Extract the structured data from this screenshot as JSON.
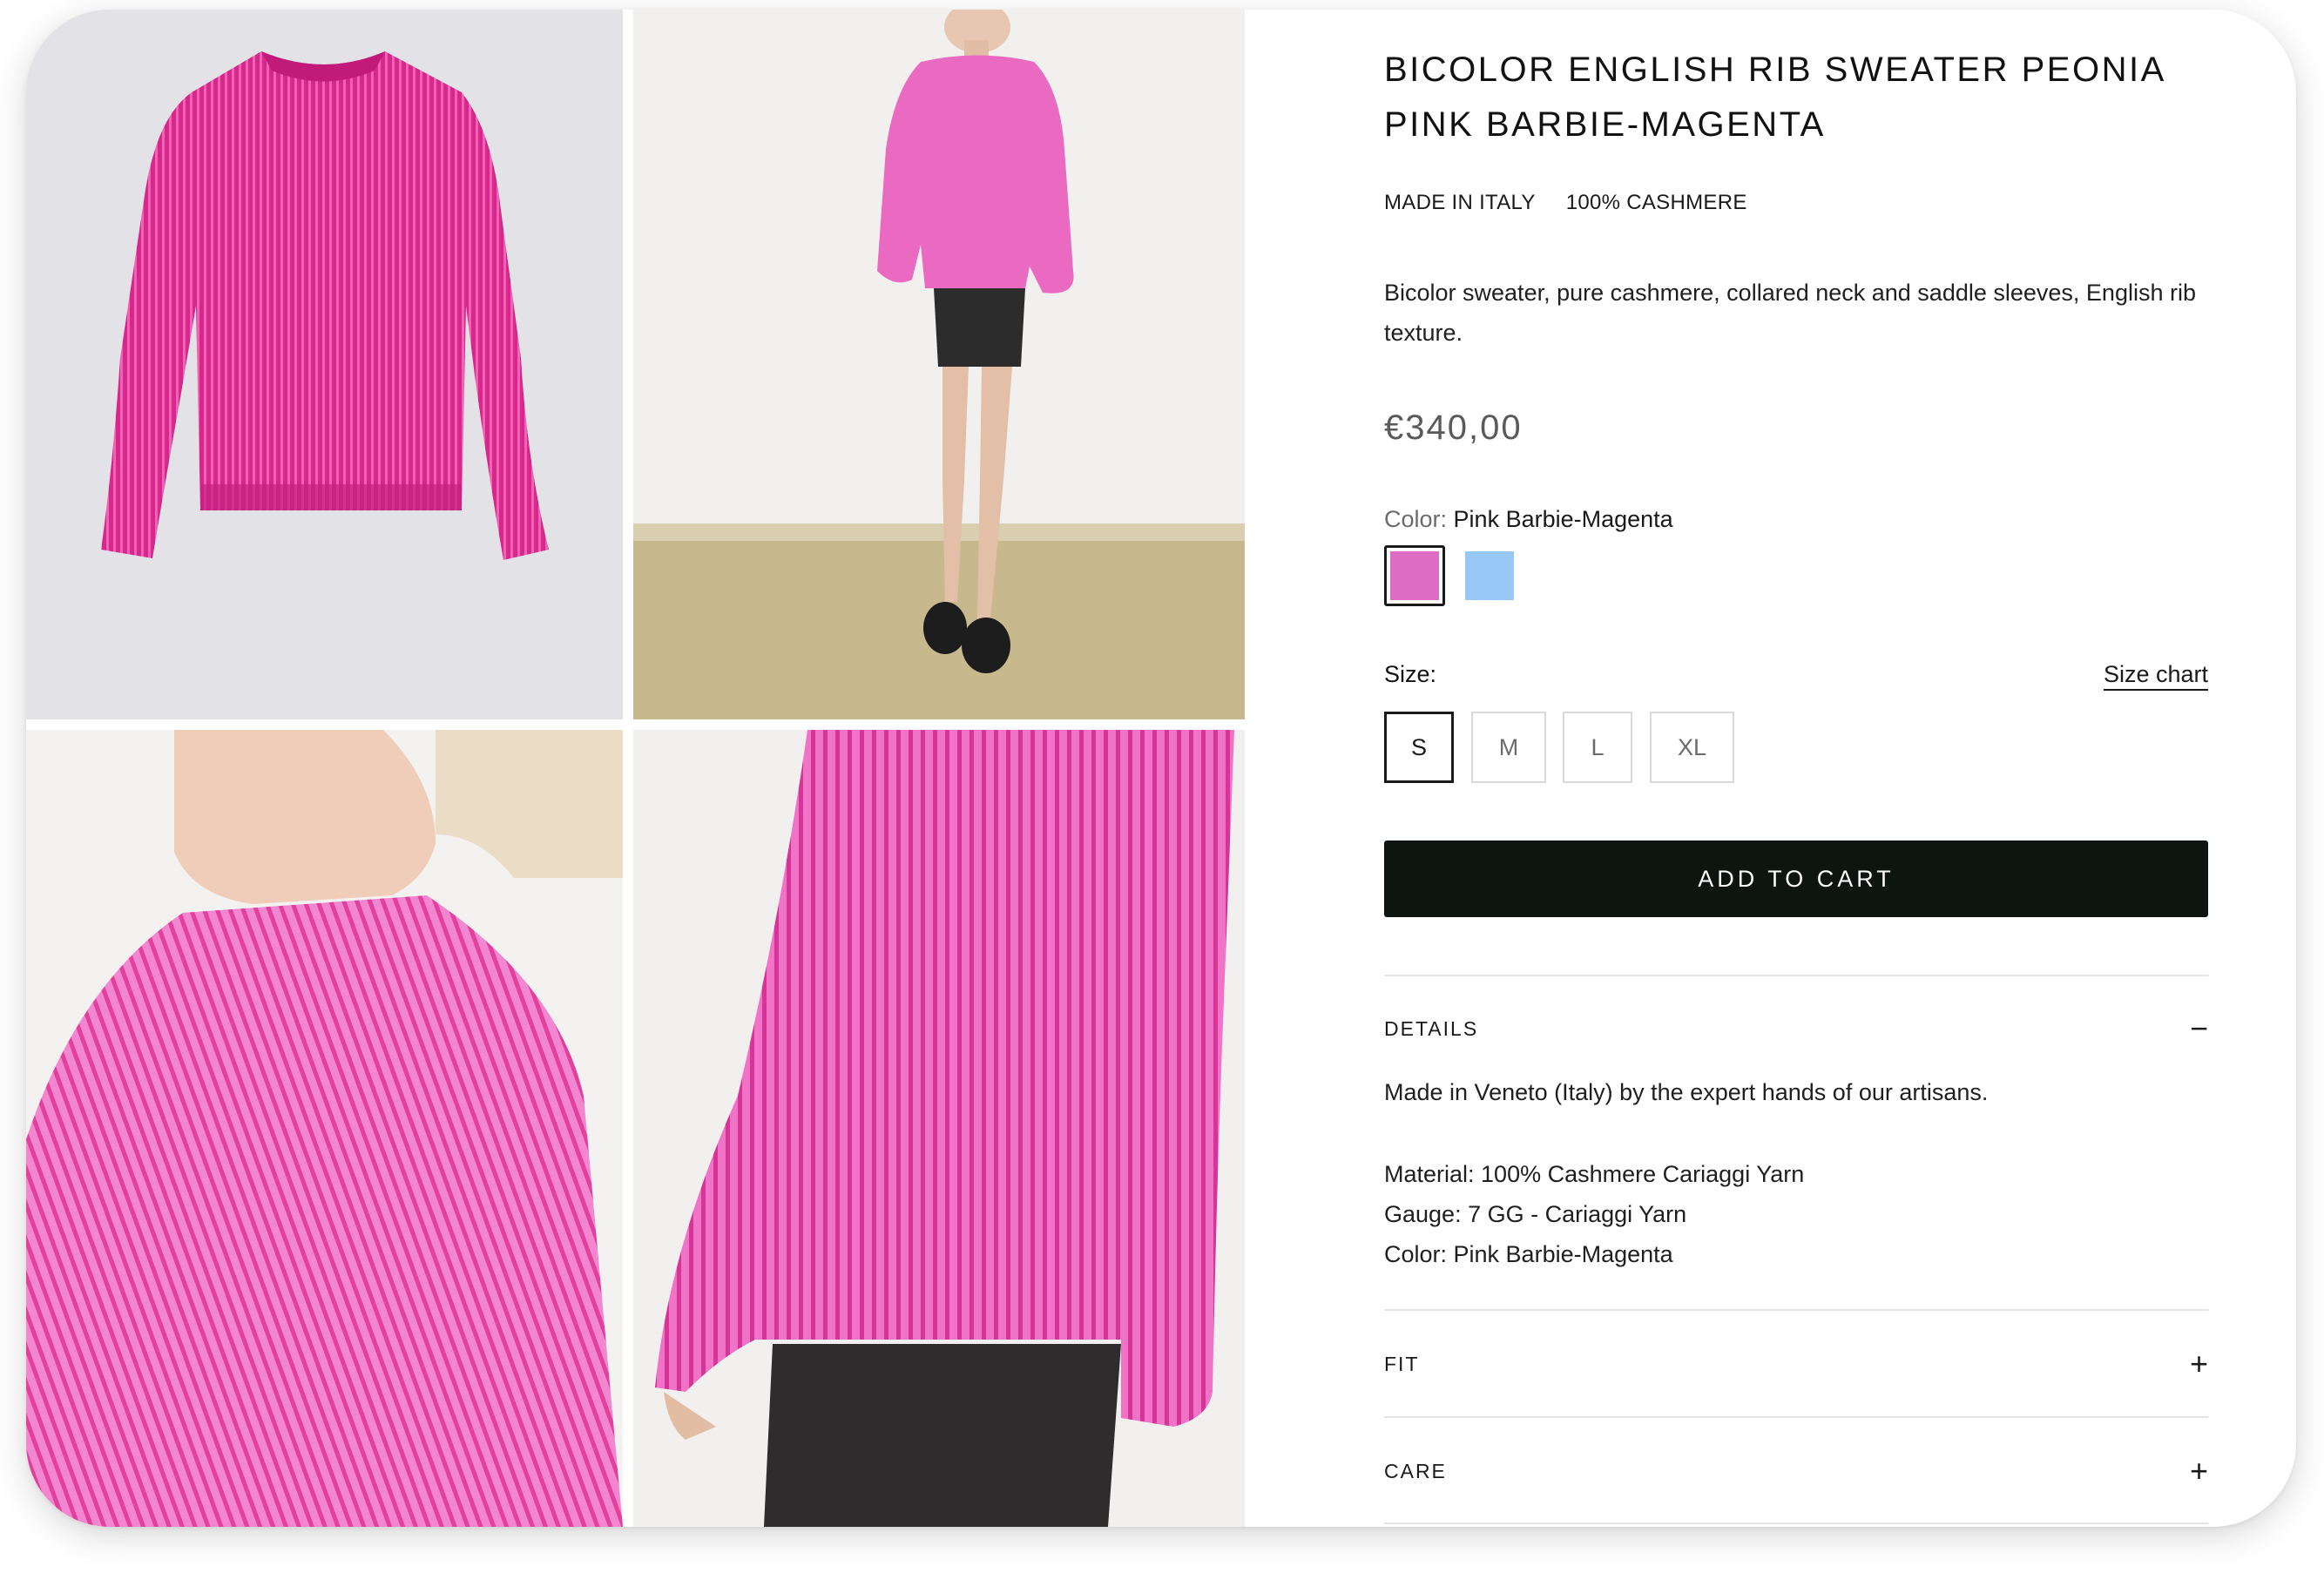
{
  "product": {
    "title": "BICOLOR ENGLISH RIB SWEATER PEONIA PINK BARBIE-MAGENTA",
    "tags": [
      "MADE IN ITALY",
      "100% CASHMERE"
    ],
    "description": "Bicolor sweater, pure cashmere, collared neck and saddle sleeves, English rib texture.",
    "price": "€340,00"
  },
  "color": {
    "label": "Color:",
    "value": "Pink Barbie-Magenta",
    "swatches": [
      {
        "name": "pink-barbie-magenta",
        "hex": "#de6dc4",
        "selected": true
      },
      {
        "name": "light-blue",
        "hex": "#98c9f6",
        "selected": false
      }
    ]
  },
  "size": {
    "label": "Size:",
    "chart_link": "Size chart",
    "options": [
      "S",
      "M",
      "L",
      "XL"
    ],
    "selected": "S"
  },
  "cart": {
    "button_label": "ADD TO CART"
  },
  "accordions": {
    "details": {
      "label": "DETAILS",
      "icon": "minus-icon",
      "expanded": true,
      "lines": [
        "Made in Veneto (Italy) by the expert hands of our artisans.",
        "Material: 100% Cashmere Cariaggi Yarn",
        "Gauge: 7 GG - Cariaggi Yarn",
        "Color: Pink Barbie-Magenta"
      ]
    },
    "fit": {
      "label": "FIT",
      "icon": "plus-icon",
      "expanded": false
    },
    "care": {
      "label": "CARE",
      "icon": "plus-icon",
      "expanded": false
    }
  },
  "gallery": {
    "images": [
      "sweater-flat-lay",
      "model-full-body",
      "model-shoulder-closeup",
      "sweater-sleeve-detail"
    ]
  },
  "colors": {
    "sweater_pink": "#e0308f",
    "sweater_light_pink": "#f07dc6",
    "button_dark": "#0e1511"
  }
}
